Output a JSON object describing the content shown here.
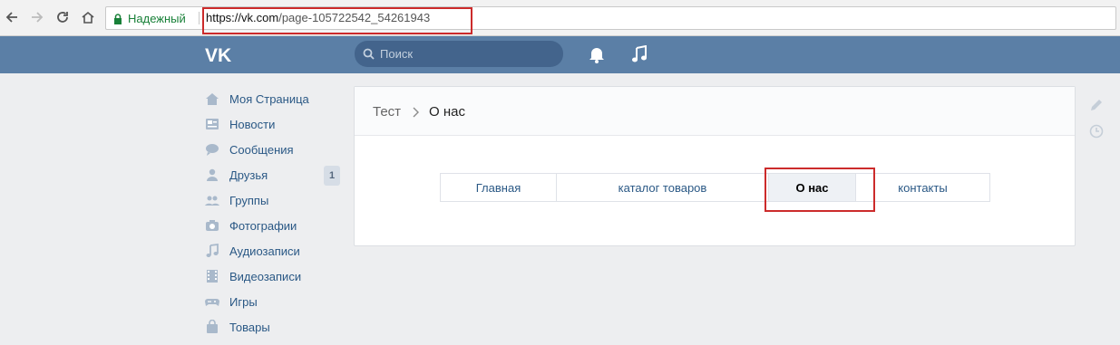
{
  "browser": {
    "secure_label": "Надежный",
    "url_scheme_host": "https://vk.com",
    "url_path": "/page-105722542_54261943"
  },
  "header": {
    "search_placeholder": "Поиск"
  },
  "sidebar": {
    "items": [
      {
        "label": "Моя Страница",
        "icon": "home-icon"
      },
      {
        "label": "Новости",
        "icon": "news-icon"
      },
      {
        "label": "Сообщения",
        "icon": "messages-icon"
      },
      {
        "label": "Друзья",
        "icon": "friends-icon",
        "badge": "1"
      },
      {
        "label": "Группы",
        "icon": "groups-icon"
      },
      {
        "label": "Фотографии",
        "icon": "camera-icon"
      },
      {
        "label": "Аудиозаписи",
        "icon": "music-note-icon"
      },
      {
        "label": "Видеозаписи",
        "icon": "film-icon"
      },
      {
        "label": "Игры",
        "icon": "gamepad-icon"
      },
      {
        "label": "Товары",
        "icon": "shopping-bag-icon"
      }
    ]
  },
  "page": {
    "breadcrumb_parent": "Тест",
    "breadcrumb_current": "О нас",
    "menu": [
      "Главная",
      "каталог товаров",
      "О нас",
      "контакты"
    ],
    "active_menu": "О нас"
  },
  "colors": {
    "header": "#5b7fa6",
    "link": "#2a5885",
    "highlight": "#cc2b2b"
  }
}
